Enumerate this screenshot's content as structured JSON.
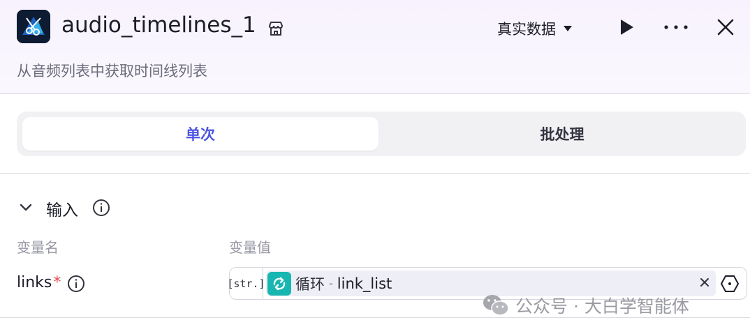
{
  "header": {
    "app_icon": "video-editor-app-icon",
    "title": "audio_timelines_1",
    "store_icon": "store-icon",
    "subtitle": "从音频列表中获取时间线列表",
    "data_select_label": "真实数据",
    "play_icon": "play-icon",
    "more_icon": "more-icon",
    "close_icon": "close-icon"
  },
  "tabs": [
    {
      "label": "单次",
      "active": true
    },
    {
      "label": "批处理",
      "active": false
    }
  ],
  "input_section": {
    "title": "输入",
    "columns": {
      "name": "变量名",
      "value": "变量值"
    },
    "rows": [
      {
        "name": "links",
        "required_mark": "*",
        "type_badge": "[str.]",
        "ref_node": "循环",
        "ref_sep": "-",
        "ref_var": "link_list"
      }
    ]
  },
  "watermark": {
    "text": "公众号 · 大白学智能体"
  },
  "colors": {
    "accent": "#4c55e0",
    "loop_icon_bg": "#18b6b0",
    "required": "#e5484d"
  }
}
